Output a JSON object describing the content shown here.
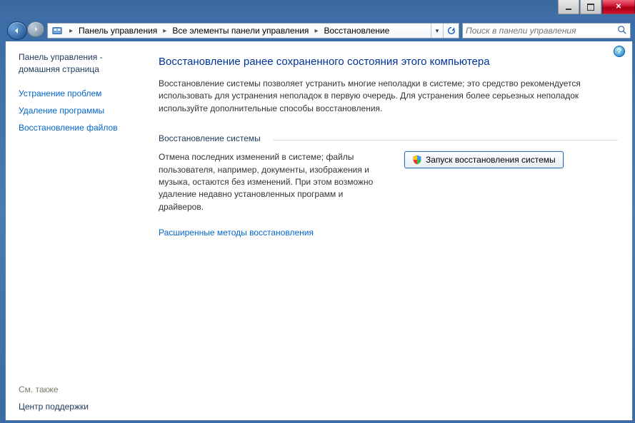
{
  "titlebar": {
    "minimize": "min",
    "maximize": "max",
    "close": "✕"
  },
  "breadcrumb": {
    "items": [
      "Панель управления",
      "Все элементы панели управления",
      "Восстановление"
    ]
  },
  "search": {
    "placeholder": "Поиск в панели управления"
  },
  "sidebar": {
    "home": "Панель управления - домашняя страница",
    "links": [
      "Устранение проблем",
      "Удаление программы",
      "Восстановление файлов"
    ],
    "see_also_label": "См. также",
    "see_also_link": "Центр поддержки"
  },
  "main": {
    "help_tooltip": "?",
    "title": "Восстановление ранее сохраненного состояния этого компьютера",
    "intro": "Восстановление системы позволяет устранить многие неполадки в системе; это средство рекомендуется использовать для устранения неполадок в первую очередь. Для устранения более серьезных неполадок используйте дополнительные способы восстановления.",
    "group_legend": "Восстановление системы",
    "group_desc": "Отмена последних изменений в системе; файлы пользователя, например, документы, изображения и музыка, остаются без изменений. При этом возможно удаление недавно установленных программ и драйверов.",
    "action_button": "Запуск восстановления системы",
    "advanced_link": "Расширенные методы восстановления"
  }
}
